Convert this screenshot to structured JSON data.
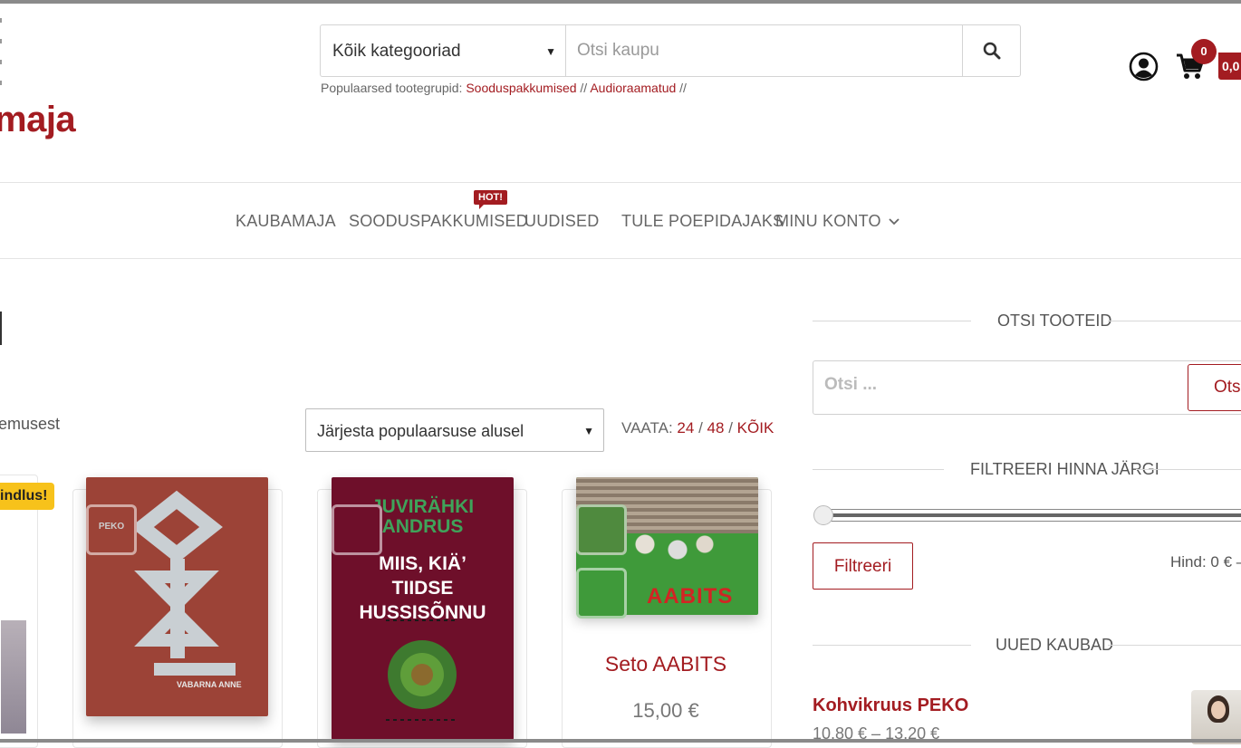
{
  "header": {
    "logo_text": "maja",
    "search": {
      "category": "Kõik kategooriad",
      "placeholder": "Otsi kaupu"
    },
    "popular_label": "Populaarsed tootegrupid:",
    "popular_links": [
      "Sooduspakkumised",
      "Audioraamatud"
    ],
    "popular_sep": "//",
    "cart_count": "0",
    "cart_total": "0,0"
  },
  "nav": {
    "items": [
      "KAUBAMAJA",
      "SOODUSPAKKUMISED",
      "UUDISED",
      "TULE POEPIDAJAKS",
      "MINU KONTO"
    ],
    "hot_badge": "HOT!"
  },
  "shop": {
    "results_text": "emusest",
    "sort_selected": "Järjesta populaarsuse alusel",
    "view_label": "VAATA:",
    "view_options": [
      "24",
      "48",
      "KÕIK"
    ],
    "view_sep": "/",
    "badge_text": "indlus!",
    "products": [
      {
        "cover_text": "VABARNA ANNE",
        "cover_logo": "PEKO"
      },
      {
        "cover_author": "JUVIRÄHKI ANDRUS",
        "cover_title_1": "MIIS, KIÄ’",
        "cover_title_2": "TIIDSE",
        "cover_title_3": "HUSSISÕNNU"
      },
      {
        "title": "Seto AABITS",
        "price": "15,00 €",
        "cover_text": "AABITS"
      }
    ]
  },
  "sidebar": {
    "search_heading": "OTSI TOOTEID",
    "search_placeholder": "Otsi ...",
    "search_button": "Otsi",
    "price_heading": "FILTREERI HINNA JÄRGI",
    "filter_button": "Filtreeri",
    "price_range": "Hind: 0 € —",
    "new_heading": "UUED KAUBAD",
    "new_item_title": "Kohvikruus PEKO",
    "new_item_price": "10,80 € – 13,20 €"
  }
}
